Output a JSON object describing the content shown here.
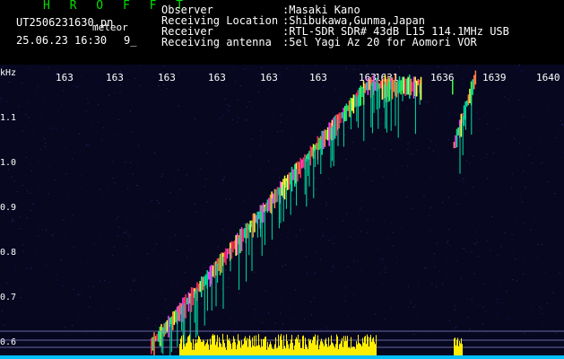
{
  "header": {
    "station_logo": "H R O F F T",
    "filename": "UT2506231630.pn",
    "label_meteor": "meteor",
    "datetime": "25.06.23 16:30",
    "counter": "9_",
    "observer_label": "Observer",
    "observer_value": ":Masaki Kano",
    "location_label": "Receiving Location",
    "location_value": ":Shibukawa,Gunma,Japan",
    "receiver_label": "Receiver",
    "receiver_value": ":RTL-SDR SDR# 43dB L15 114.1MHz USB",
    "antenna_label": "Receiving antenna",
    "antenna_value": ":5el Yagi Az 20 for Aomori VOR"
  },
  "colors": {
    "background": "#070720",
    "trace": "#ff3060",
    "trace_alt": "#00e0a0",
    "yellow_band": "#ffee00",
    "cyan_floor": "#00c0ff",
    "axis_text": "#ffffff"
  },
  "chart_data": {
    "type": "heatmap",
    "ylabel": "kHz",
    "y_ticks": [
      "1.1",
      "1.0",
      "0.9",
      "0.8",
      "0.7",
      "0.6"
    ],
    "x_ticks": [
      "163",
      "163",
      "163",
      "163",
      "163",
      "163",
      "163",
      "1631",
      "1636",
      "1639",
      "1640"
    ]
  }
}
